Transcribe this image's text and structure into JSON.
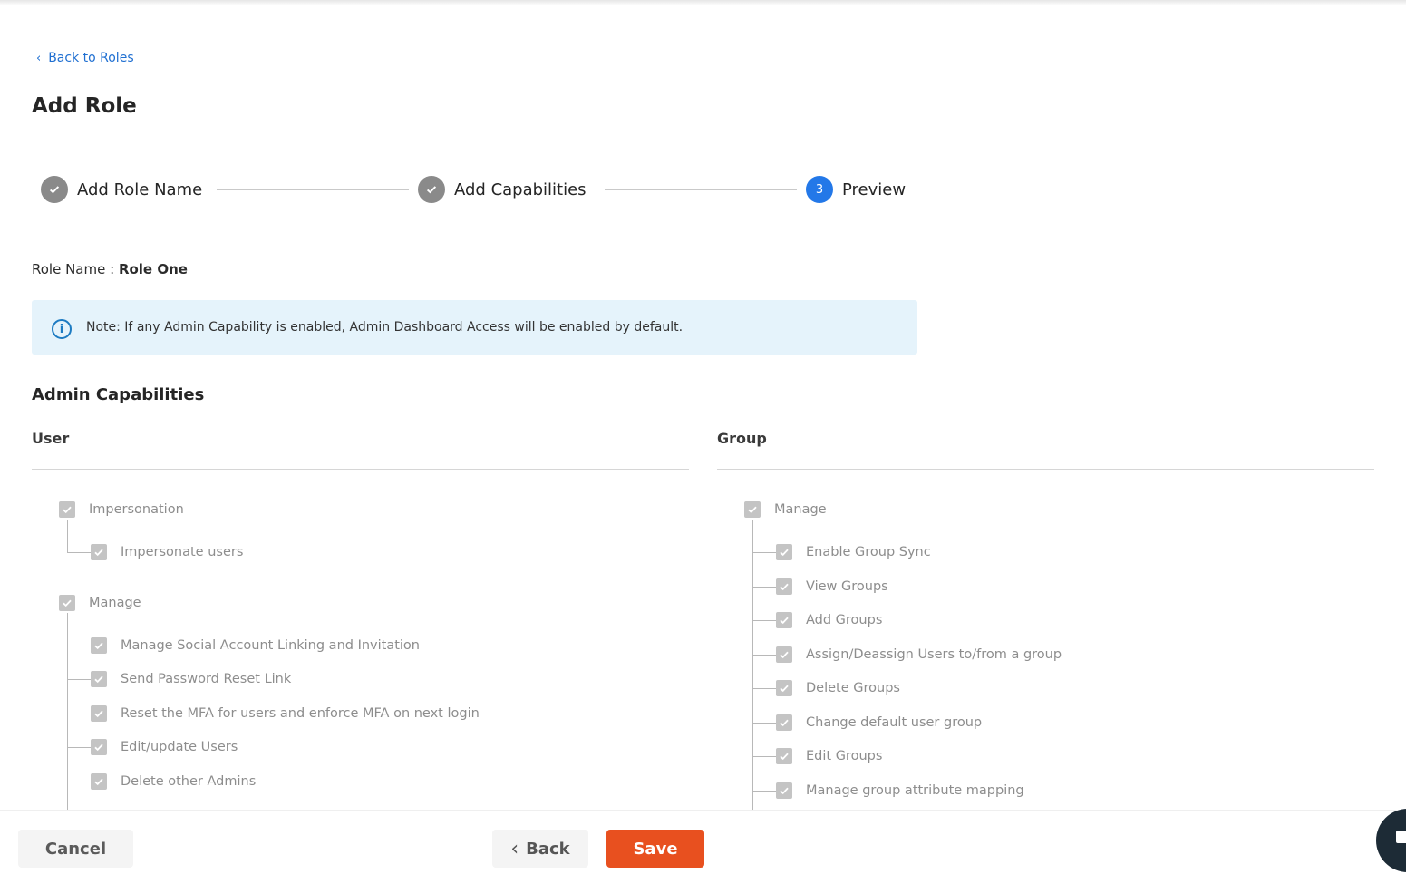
{
  "nav": {
    "back_label": "Back to Roles"
  },
  "page": {
    "title": "Add Role"
  },
  "stepper": {
    "steps": [
      {
        "label": "Add Role Name",
        "state": "done"
      },
      {
        "label": "Add Capabilities",
        "state": "done"
      },
      {
        "label": "Preview",
        "state": "active",
        "number": "3"
      }
    ]
  },
  "role": {
    "label": "Role Name : ",
    "value": "Role One"
  },
  "note": {
    "text": "Note: If any Admin Capability is enabled, Admin Dashboard Access will be enabled by default."
  },
  "section": {
    "title": "Admin Capabilities"
  },
  "user_column": {
    "heading": "User",
    "groups": [
      {
        "label": "Impersonation",
        "checked": true,
        "children": [
          "Impersonate users"
        ]
      },
      {
        "label": "Manage",
        "checked": true,
        "children": [
          "Manage Social Account Linking and Invitation",
          "Send Password Reset Link",
          "Reset the MFA for users and enforce MFA on next login",
          "Edit/update Users",
          "Delete other Admins"
        ]
      }
    ]
  },
  "group_column": {
    "heading": "Group",
    "groups": [
      {
        "label": "Manage",
        "checked": true,
        "children": [
          "Enable Group Sync",
          "View Groups",
          "Add Groups",
          "Assign/Deassign Users to/from a group",
          "Delete Groups",
          "Change default user group",
          "Edit Groups",
          "Manage group attribute mapping"
        ]
      }
    ]
  },
  "footer": {
    "cancel_label": "Cancel",
    "back_label": "Back",
    "save_label": "Save"
  },
  "colors": {
    "accent": "#2378e8",
    "save": "#e8501f",
    "note_bg": "#e5f3fb",
    "link": "#1f6fd1"
  }
}
